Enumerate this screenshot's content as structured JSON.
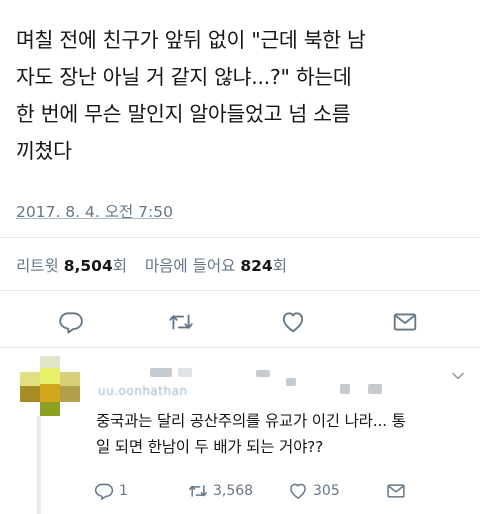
{
  "tweet": {
    "text_lines": [
      "며칠 전에 친구가 앞뒤 없이 \"근데 북한 남",
      "자도 장난 아닐 거 같지 않냐...?\" 하는데",
      "한 번에 무슨 말인지 알아들었고 넘 소름",
      "끼쳤다"
    ],
    "date": "2017. 8. 4. 오전 7:50",
    "stats": {
      "retweet_label": "리트윗",
      "retweet_count": "8,504",
      "retweet_unit": "회",
      "like_label": "마음에 들어요",
      "like_count": "824",
      "like_unit": "회"
    },
    "actions": [
      {
        "name": "reply",
        "icon": "reply-icon"
      },
      {
        "name": "retweet",
        "icon": "retweet-icon"
      },
      {
        "name": "like",
        "icon": "heart-icon"
      },
      {
        "name": "message",
        "icon": "envelope-icon"
      }
    ]
  },
  "reply": {
    "handle_partial": "uu.oonhathan",
    "text_lines": [
      "중국과는 달리 공산주의를 유교가 이긴 나라... 통",
      "일 되면 한남이 두 배가 되는 거야??"
    ],
    "stats": {
      "reply_count": "1",
      "retweet_count": "3,568",
      "like_count": "305"
    }
  },
  "colors": {
    "text": "#14171a",
    "secondary": "#657786",
    "icon": "#657786",
    "divider": "#e1e8ed"
  }
}
